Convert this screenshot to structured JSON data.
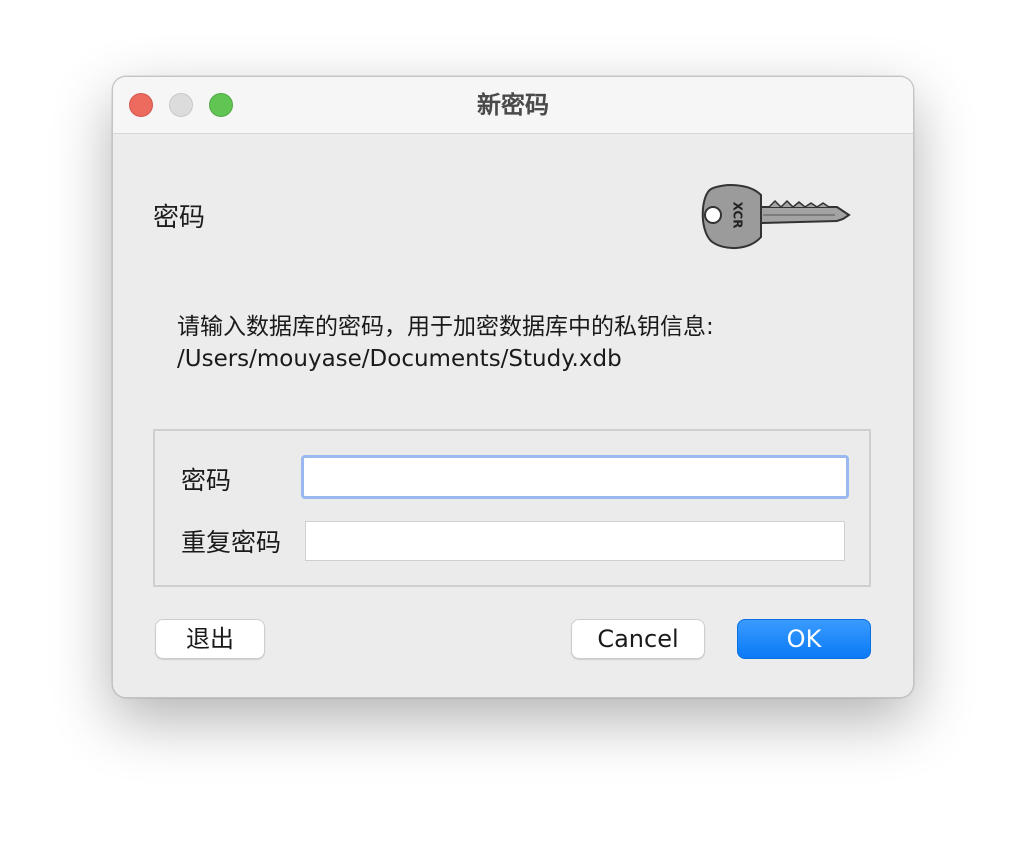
{
  "window": {
    "title": "新密码",
    "controls": {
      "close": {
        "icon": "close-traffic-light",
        "color": "#ec6a5e"
      },
      "minimize": {
        "icon": "minimize-traffic-light",
        "color": "#dcdcdc"
      },
      "zoom": {
        "icon": "zoom-traffic-light",
        "color": "#61c554"
      }
    }
  },
  "header": {
    "heading": "密码",
    "icon": "key-icon",
    "key_engraving": "XCR"
  },
  "description": {
    "line1": "请输入数据库的密码，用于加密数据库中的私钥信息:",
    "line2": "/Users/mouyase/Documents/Study.xdb"
  },
  "form": {
    "password_label": "密码",
    "password_value": "",
    "repeat_label": "重复密码",
    "repeat_value": ""
  },
  "buttons": {
    "quit_label": "退出",
    "cancel_label": "Cancel",
    "ok_label": "OK"
  },
  "colors": {
    "accent": "#0a7af6",
    "focus_ring": "#9ab9f0"
  }
}
